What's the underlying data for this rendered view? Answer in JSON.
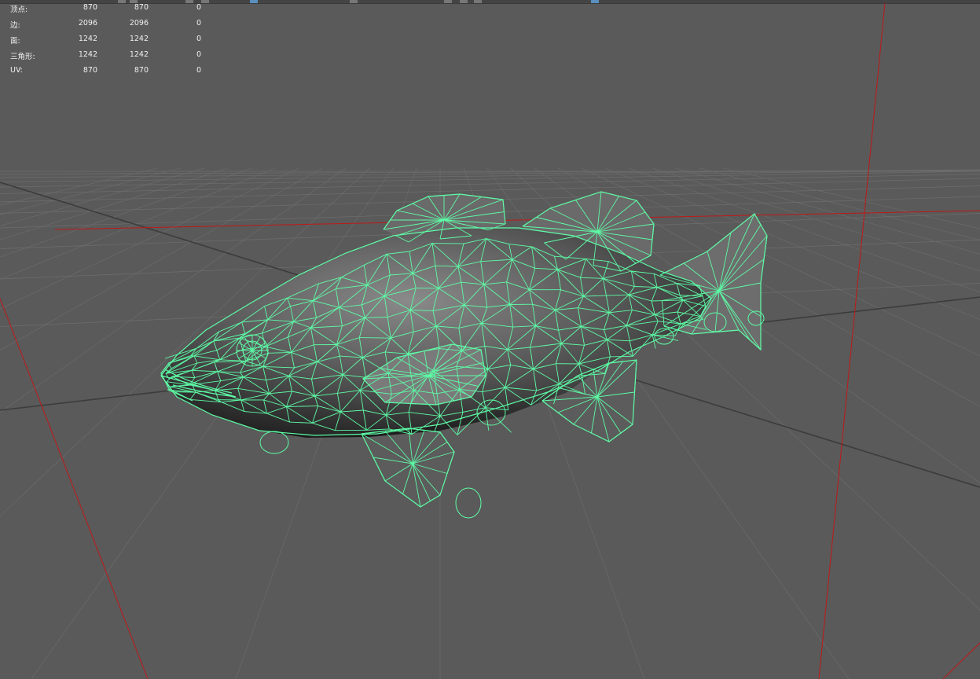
{
  "hud": {
    "rows": [
      {
        "label": "顶点:",
        "v1": "870",
        "v2": "870",
        "v3": "0"
      },
      {
        "label": "边:",
        "v1": "2096",
        "v2": "2096",
        "v3": "0"
      },
      {
        "label": "面:",
        "v1": "1242",
        "v2": "1242",
        "v3": "0"
      },
      {
        "label": "三角形:",
        "v1": "1242",
        "v2": "1242",
        "v3": "0"
      },
      {
        "label": "UV:",
        "v1": "870",
        "v2": "870",
        "v3": "0"
      }
    ]
  },
  "scene": {
    "background_color": "#5a5a5a",
    "grid_color": "#6e6e6e",
    "axis_color": "#3f3f3f",
    "camera_frustum_color": "#c01818",
    "wireframe_color": "#5dfca6",
    "mesh_shade_light": "#8a8a8a",
    "mesh_shade_dark": "#202020"
  }
}
